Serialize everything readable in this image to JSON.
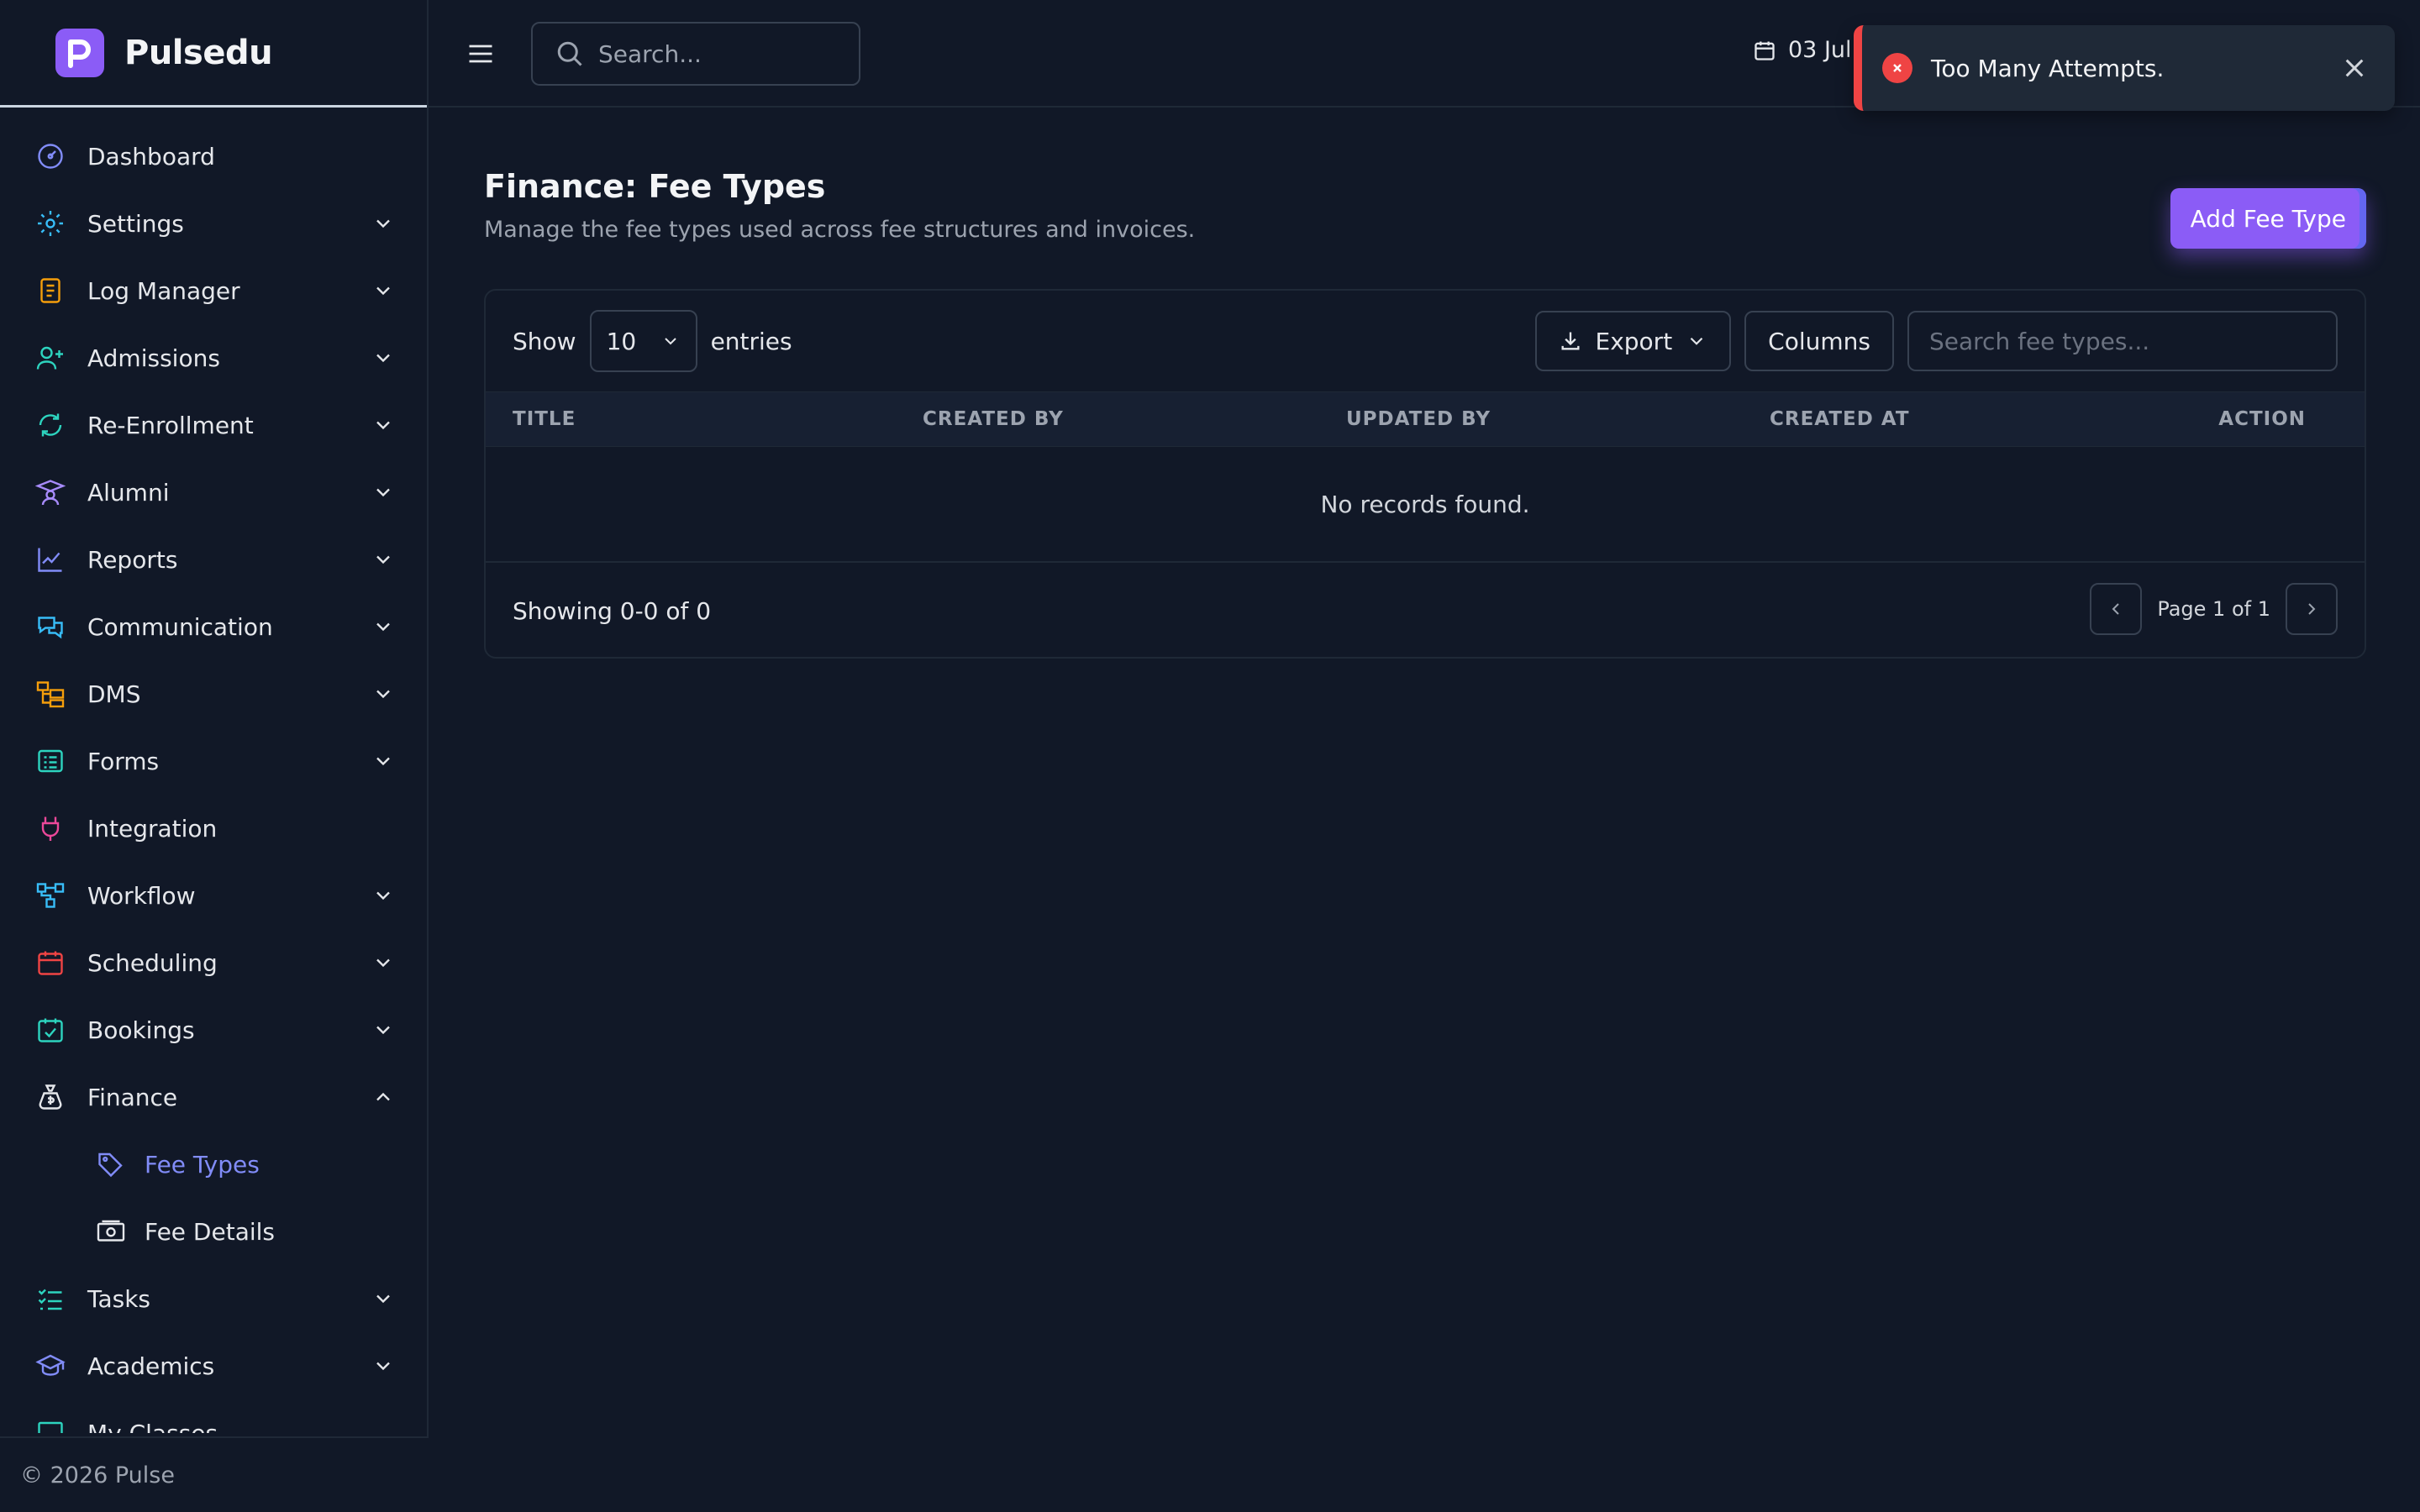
{
  "app": {
    "name": "Pulsedu"
  },
  "colors": {
    "accent": "#8b5cf6",
    "active_link": "#818cf8",
    "error": "#ef4444",
    "background": "#111827"
  },
  "topbar": {
    "search_placeholder": "Search...",
    "date": "03 Jul"
  },
  "toast": {
    "message": "Too Many Attempts."
  },
  "sidebar": {
    "items": [
      {
        "label": "Dashboard",
        "icon": "dashboard-gauge-icon"
      },
      {
        "label": "Settings",
        "icon": "gear-icon"
      },
      {
        "label": "Log Manager",
        "icon": "clipboard-icon"
      },
      {
        "label": "Admissions",
        "icon": "user-plus-icon"
      },
      {
        "label": "Re-Enrollment",
        "icon": "refresh-icon"
      },
      {
        "label": "Alumni",
        "icon": "graduate-icon"
      },
      {
        "label": "Reports",
        "icon": "line-chart-icon"
      },
      {
        "label": "Communication",
        "icon": "chat-bubbles-icon"
      },
      {
        "label": "DMS",
        "icon": "folders-icon"
      },
      {
        "label": "Forms",
        "icon": "form-list-icon"
      },
      {
        "label": "Integration",
        "icon": "plug-icon"
      },
      {
        "label": "Workflow",
        "icon": "workflow-icon"
      },
      {
        "label": "Scheduling",
        "icon": "calendar-icon"
      },
      {
        "label": "Bookings",
        "icon": "calendar-check-icon"
      },
      {
        "label": "Finance",
        "icon": "money-bag-icon"
      },
      {
        "label": "Fee Types",
        "icon": "tags-icon"
      },
      {
        "label": "Fee Details",
        "icon": "banknote-icon"
      },
      {
        "label": "Tasks",
        "icon": "checklist-icon"
      },
      {
        "label": "Academics",
        "icon": "mortarboard-icon"
      },
      {
        "label": "My Classes",
        "icon": "chalkboard-icon"
      }
    ],
    "footer": "© 2026 Pulse"
  },
  "page": {
    "title": "Finance: Fee Types",
    "subtitle": "Manage the fee types used across fee structures and invoices.",
    "add_button": "Add Fee Type"
  },
  "table": {
    "show_label": "Show",
    "entries_value": "10",
    "entries_label": "entries",
    "export_label": "Export",
    "columns_label": "Columns",
    "search_placeholder": "Search fee types...",
    "headers": [
      "TITLE",
      "CREATED BY",
      "UPDATED BY",
      "CREATED AT",
      "ACTION"
    ],
    "empty_text": "No records found.",
    "showing_text": "Showing 0-0 of 0",
    "page_label": "Page 1 of 1"
  }
}
